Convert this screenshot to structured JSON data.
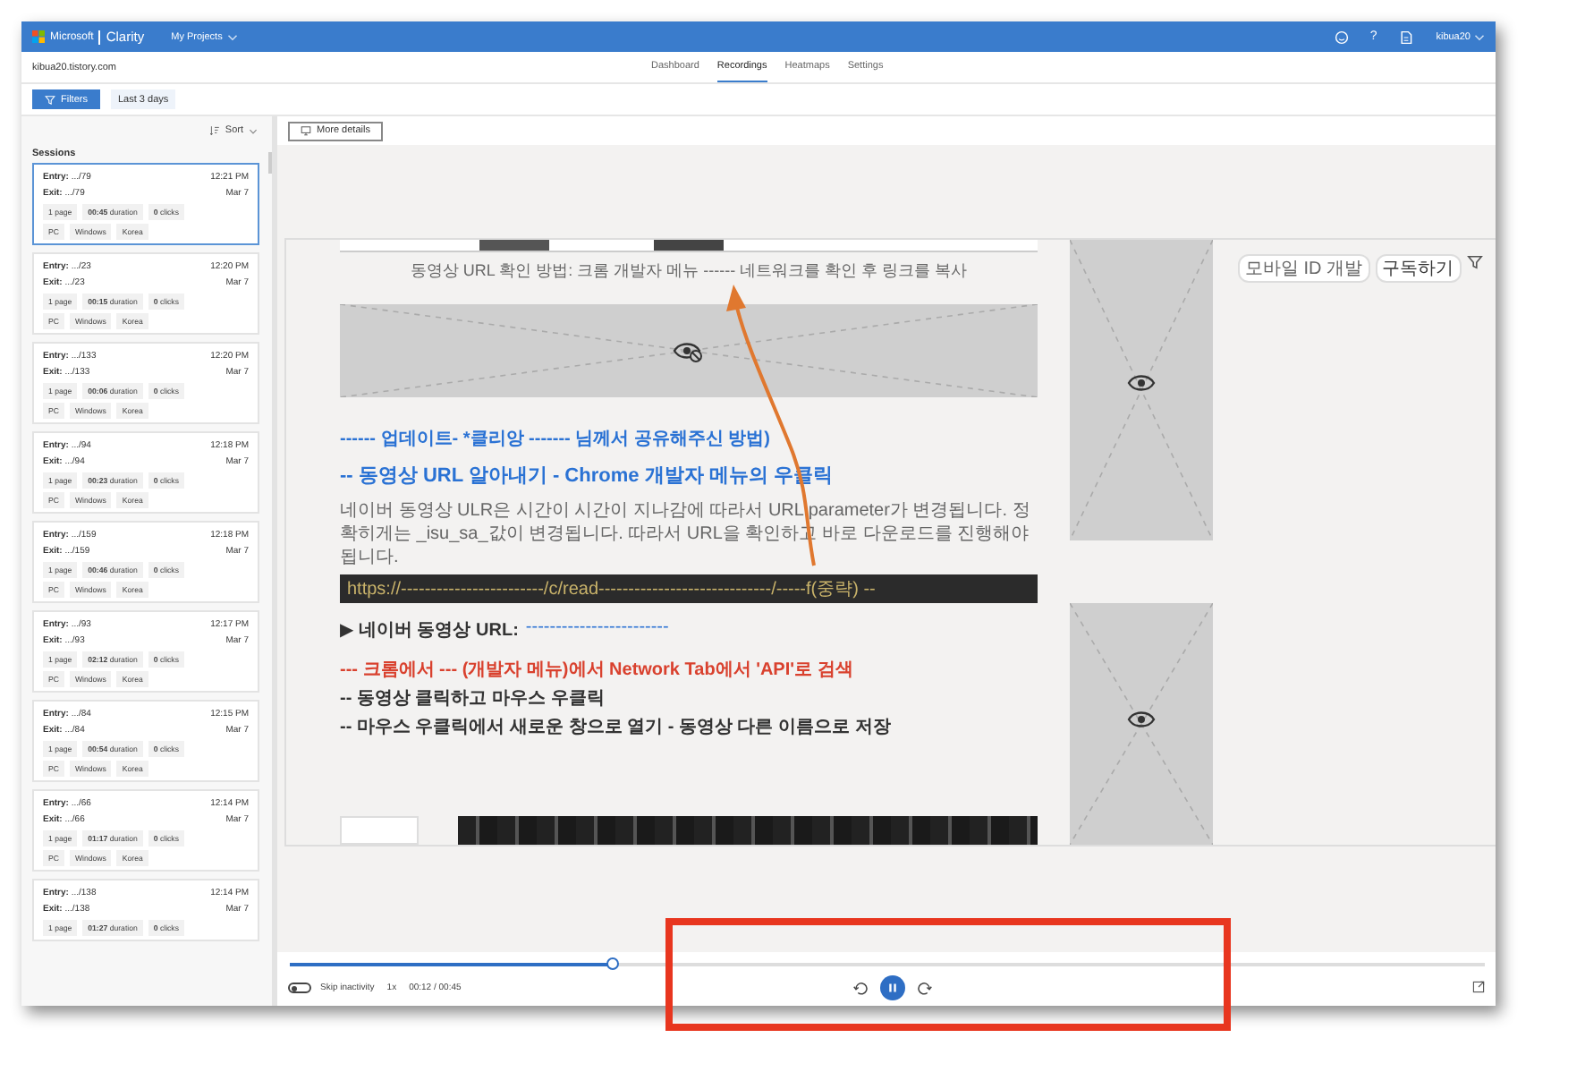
{
  "header": {
    "brand": "Microsoft",
    "product": "Clarity",
    "project_menu": "My Projects",
    "help_glyph": "?",
    "user": "kibua20"
  },
  "site": "kibua20.tistory.com",
  "tabs": [
    {
      "label": "Dashboard",
      "selected": false
    },
    {
      "label": "Recordings",
      "selected": true
    },
    {
      "label": "Heatmaps",
      "selected": false
    },
    {
      "label": "Settings",
      "selected": false
    }
  ],
  "filters": {
    "button": "Filters",
    "date_range": "Last 3 days"
  },
  "sidebar": {
    "sort": "Sort",
    "heading": "Sessions",
    "sessions": [
      {
        "entry": "**Entry:** .../79",
        "exit": "**Exit:** .../79",
        "time": "12:21 PM",
        "date": "Mar 7",
        "pages": "1 page",
        "duration": "**00:45** duration",
        "clicks": "**0** clicks",
        "tags": [
          "PC",
          "Windows",
          "Korea"
        ],
        "selected": true
      },
      {
        "entry": "**Entry:** .../23",
        "exit": "**Exit:** .../23",
        "time": "12:20 PM",
        "date": "Mar 7",
        "pages": "1 page",
        "duration": "**00:15** duration",
        "clicks": "**0** clicks",
        "tags": [
          "PC",
          "Windows",
          "Korea"
        ],
        "selected": false
      },
      {
        "entry": "**Entry:** .../133",
        "exit": "**Exit:** .../133",
        "time": "12:20 PM",
        "date": "Mar 7",
        "pages": "1 page",
        "duration": "**00:06** duration",
        "clicks": "**0** clicks",
        "tags": [
          "PC",
          "Windows",
          "Korea"
        ],
        "selected": false
      },
      {
        "entry": "**Entry:** .../94",
        "exit": "**Exit:** .../94",
        "time": "12:18 PM",
        "date": "Mar 7",
        "pages": "1 page",
        "duration": "**00:23** duration",
        "clicks": "**0** clicks",
        "tags": [
          "PC",
          "Windows",
          "Korea"
        ],
        "selected": false
      },
      {
        "entry": "**Entry:** .../159",
        "exit": "**Exit:** .../159",
        "time": "12:18 PM",
        "date": "Mar 7",
        "pages": "1 page",
        "duration": "**00:46** duration",
        "clicks": "**0** clicks",
        "tags": [
          "PC",
          "Windows",
          "Korea"
        ],
        "selected": false
      },
      {
        "entry": "**Entry:** .../93",
        "exit": "**Exit:** .../93",
        "time": "12:17 PM",
        "date": "Mar 7",
        "pages": "1 page",
        "duration": "**02:12** duration",
        "clicks": "**0** clicks",
        "tags": [
          "PC",
          "Windows",
          "Korea"
        ],
        "selected": false
      },
      {
        "entry": "**Entry:** .../84",
        "exit": "**Exit:** .../84",
        "time": "12:15 PM",
        "date": "Mar 7",
        "pages": "1 page",
        "duration": "**00:54** duration",
        "clicks": "**0** clicks",
        "tags": [
          "PC",
          "Windows",
          "Korea"
        ],
        "selected": false
      },
      {
        "entry": "**Entry:** .../66",
        "exit": "**Exit:** .../66",
        "time": "12:14 PM",
        "date": "Mar 7",
        "pages": "1 page",
        "duration": "**01:17** duration",
        "clicks": "**0** clicks",
        "tags": [
          "PC",
          "Windows",
          "Korea"
        ],
        "selected": false
      },
      {
        "entry": "**Entry:** .../138",
        "exit": "**Exit:** .../138",
        "time": "12:14 PM",
        "date": "Mar 7",
        "pages": "1 page",
        "duration": "**01:27** duration",
        "clicks": "**0** clicks",
        "selected": false
      }
    ]
  },
  "toolbar": {
    "more_details": "More details"
  },
  "recording": {
    "caption": "동영상 URL 확인 방법: 크롬 개발자 메뉴 ------ 네트워크를 확인 후 링크를 복사",
    "update_note": "------ 업데이트- *클리앙 ------- 님께서 공유해주신 방법)",
    "heading": "-- 동영상 URL 알아내기 -  Chrome 개발자 메뉴의 우클릭",
    "paragraph": "네이버 동영상 ULR은 시간이 시간이 지나감에 따라서 URL parameter가 변경됩니다.  정확히게는 _isu_sa_값이 변경됩니다. 따라서 URL을 확인하고 바로 다운로드를 진행해야 됩니다.",
    "code": "https://------------------------/c/read-----------------------------/-----f(중략) --",
    "url_line": {
      "label": "▶ 네이버 동영상 URL:",
      "value": "------------------------"
    },
    "steps": [
      {
        "kind": "alert",
        "text": "--- 크롬에서 --- (개발자 메뉴)에서 Network Tab에서 'API'로 검색"
      },
      {
        "kind": "bullet",
        "text": "-- 동영상 클릭하고 마우스 우클릭"
      },
      {
        "kind": "bullet",
        "text": "-- 마우스 우클릭에서 새로운 창으로 열기 - 동영상 다른 이름으로 저장"
      }
    ],
    "widget": {
      "label": "모바일 ID 개발",
      "subscribe": "구독하기"
    }
  },
  "player": {
    "level": 0.27,
    "skip_inactivity": {
      "label": "Skip inactivity",
      "on": false
    },
    "speed": "1x",
    "time": "00:12 / 00:45",
    "playing": true
  }
}
